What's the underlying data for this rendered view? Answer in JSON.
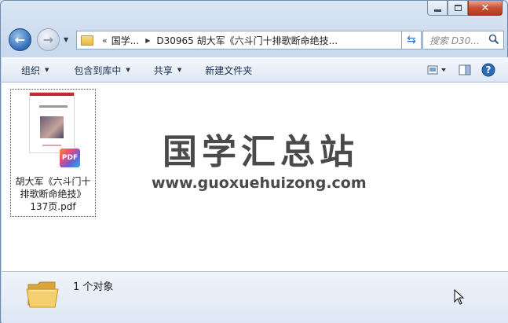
{
  "window": {
    "caption_buttons": [
      "minimize",
      "maximize",
      "close"
    ]
  },
  "nav": {
    "address_chevron": "«",
    "crumbs": [
      "国学...",
      "D30965 胡大军《六斗门十排歌断命绝技..."
    ],
    "search_placeholder": "搜索 D30..."
  },
  "toolbar": {
    "organize": "组织",
    "include_library": "包含到库中",
    "share": "共享",
    "new_folder": "新建文件夹"
  },
  "content": {
    "file": {
      "name_lines": [
        "胡大军《六斗门十",
        "排歌断命绝技》",
        "137页.pdf"
      ],
      "badge": "PDF"
    },
    "watermark_title": "国学汇总站",
    "watermark_url": "www.guoxuehuizong.com"
  },
  "details": {
    "count": "1 个对象"
  },
  "colors": {
    "accent": "#2f6ab7",
    "close": "#c75138",
    "folder": "#e9b73f"
  }
}
